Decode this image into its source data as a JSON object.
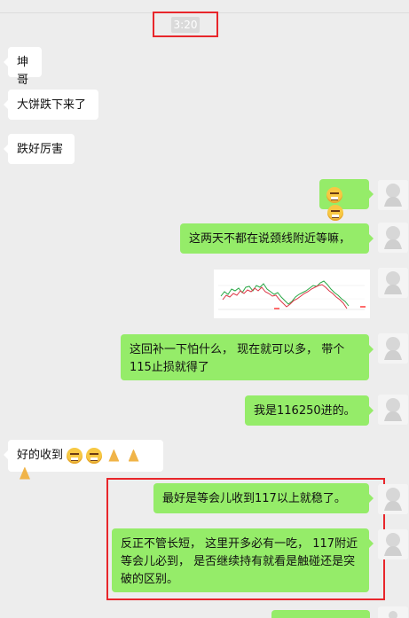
{
  "chat": {
    "time": "3:20",
    "messages": [
      {
        "side": "left",
        "text": "坤哥"
      },
      {
        "side": "left",
        "text": "大饼跌下来了"
      },
      {
        "side": "left",
        "text": "跌好厉害"
      },
      {
        "side": "right",
        "emoji": "grin-icon"
      },
      {
        "side": "right",
        "text": "这两天不都在说颈线附近等嘛，"
      },
      {
        "side": "right",
        "image": "chart-image"
      },
      {
        "side": "right",
        "text": "这回补一下怕什么， 现在就可以多， 带个115止损就得了"
      },
      {
        "side": "right",
        "text": "我是116250进的。"
      },
      {
        "side": "left",
        "text": "好的收到"
      },
      {
        "side": "right",
        "text": "最好是等会儿收到117以上就稳了。"
      },
      {
        "side": "right",
        "text": "反正不管长短， 这里开多必有一吃， 117附近等会儿必到， 是否继续持有就看是触碰还是突破的区别。"
      }
    ]
  },
  "colors": {
    "left_bubble": "#ffffff",
    "right_bubble": "#95ec69",
    "background": "#ededed",
    "highlight": "#e8262b"
  }
}
